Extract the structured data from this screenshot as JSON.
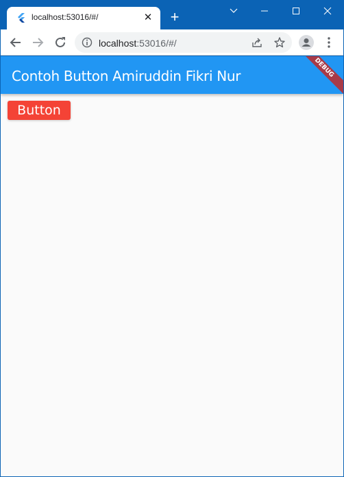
{
  "browser": {
    "tab": {
      "title": "localhost:53016/#/",
      "close_label": "✕"
    },
    "new_tab_label": "+",
    "address": {
      "host": "localhost",
      "path": ":53016/#/"
    }
  },
  "app": {
    "title": "Contoh Button Amiruddin Fikri Nur",
    "debug_label": "DEBUG",
    "button_label": "Button"
  },
  "colors": {
    "appbar": "#2196f3",
    "button": "#f44336",
    "window_frame": "#0b63b5",
    "debug_banner": "#a83a48"
  },
  "icons": [
    "flutter-favicon-icon",
    "close-icon",
    "plus-icon",
    "chevron-down-icon",
    "minimize-icon",
    "maximize-icon",
    "close-window-icon",
    "back-arrow-icon",
    "forward-arrow-icon",
    "reload-icon",
    "info-icon",
    "share-icon",
    "star-icon",
    "profile-icon",
    "kebab-menu-icon"
  ]
}
